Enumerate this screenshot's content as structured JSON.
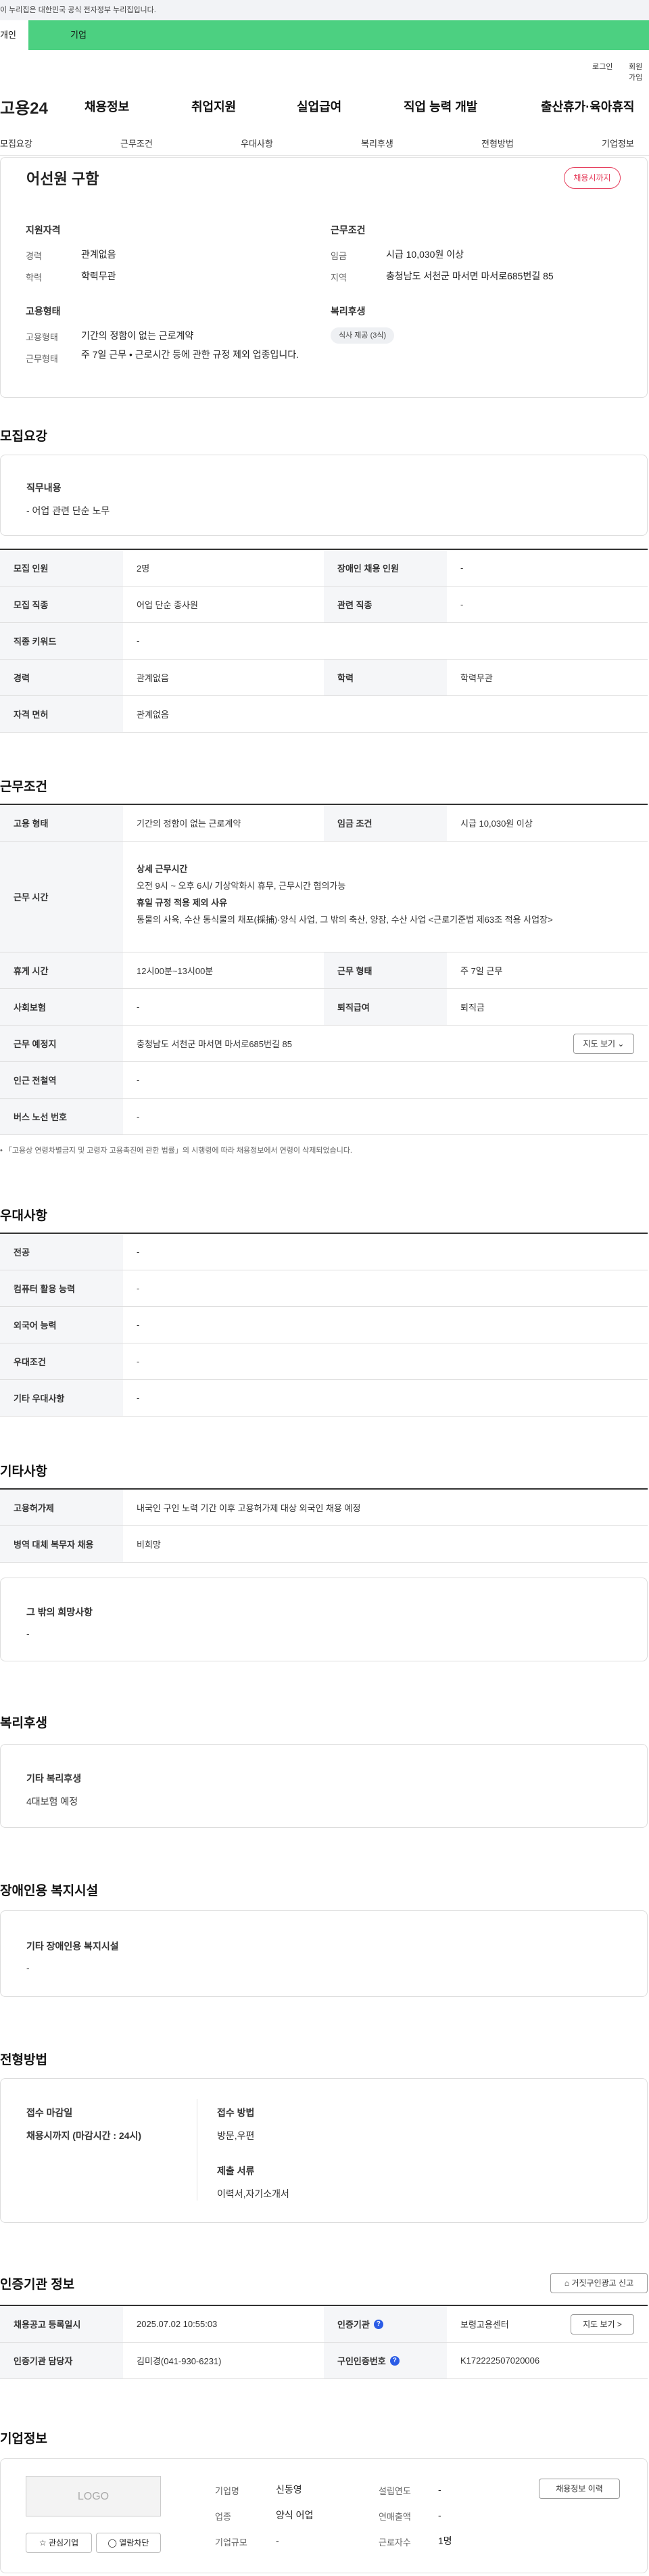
{
  "gov_banner": "이 누리집은 대한민국 공식 전자정부 누리집입니다.",
  "user_tabs": [
    "개인",
    "기업"
  ],
  "util": {
    "login": "로그인",
    "signup": "회원가입"
  },
  "gnb": {
    "logo": "고용24",
    "menus": [
      "채용정보",
      "취업지원",
      "실업급여",
      "직업 능력 개발",
      "출산휴가·육아휴직"
    ]
  },
  "subnav": [
    "모집요강",
    "근무조건",
    "우대사항",
    "복리후생",
    "전형방법",
    "기업정보"
  ],
  "summary": {
    "title": "어선원 구함",
    "badge": "채용시까지",
    "qual_h": "지원자격",
    "cond_h": "근무조건",
    "exp_k": "경력",
    "exp_v": "관계없음",
    "edu_k": "학력",
    "edu_v": "학력무관",
    "wage_k": "임금",
    "wage_v": "시급 10,030원 이상",
    "area_k": "지역",
    "area_v": "충청남도 서천군 마서면 마서로685번길 85",
    "emp_h": "고용형태",
    "welfare_h": "복리후생",
    "type_k": "고용형태",
    "type_v": "기간의 정함이 없는 근로계약",
    "form_k": "근무형태",
    "form_v": "주 7일 근무 • 근로시간 등에 관한 규정 제외 업종입니다.",
    "chip": "식사 제공 (3식)"
  },
  "recruit": {
    "h": "모집요강",
    "duty_h": "직무내용",
    "duty_v": "- 어업 관련 단순 노무",
    "rows": [
      [
        "모집 인원",
        "2명",
        "장애인 채용 인원",
        "-"
      ],
      [
        "모집 직종",
        "어업 단순 종사원",
        "관련 직종",
        "-"
      ],
      [
        "직종 키워드",
        "-"
      ],
      [
        "경력",
        "관계없음",
        "학력",
        "학력무관"
      ],
      [
        "자격 면허",
        "관계없음"
      ]
    ]
  },
  "conditions": {
    "h": "근무조건",
    "type_k": "고용 형태",
    "type_v": "기간의 정함이 없는 근로계약",
    "wage_k": "임금 조건",
    "wage_v": "시급 10,030원 이상",
    "time_k": "근무 시간",
    "time_l1": "상세 근무시간",
    "time_l2": "오전 9시 ~ 오후 6시/ 기상악화시 휴무, 근무시간 협의가능",
    "time_l3": "휴일 규정 적용 제외 사유",
    "time_l4": "동물의 사육, 수산 동식물의 채포(採捕)·양식 사업, 그 밖의 축산, 양잠, 수산 사업 <근로기준법 제63조 적용 사업장>",
    "rest_k": "휴게 시간",
    "rest_v": "12시00분~13시00분",
    "form_k": "근무 형태",
    "form_v": "주 7일 근무",
    "ins_k": "사회보험",
    "ins_v": "-",
    "ret_k": "퇴직급여",
    "ret_v": "퇴직금",
    "place_k": "근무 예정지",
    "place_v": "충청남도 서천군 마서면 마서로685번길 85",
    "map_btn": "지도 보기 ⌄",
    "subway_k": "인근 전철역",
    "subway_v": "-",
    "bus_k": "버스 노선 번호",
    "bus_v": "-",
    "note": "「고용상 연령차별금지 및 고령자 고용촉진에 관한 법률」의 시행령에 따라 채용정보에서 연령이 삭제되었습니다."
  },
  "prefer": {
    "h": "우대사항",
    "rows": [
      [
        "전공",
        "-"
      ],
      [
        "컴퓨터 활용 능력",
        "-"
      ],
      [
        "외국어 능력",
        "-"
      ],
      [
        "우대조건",
        "-"
      ],
      [
        "기타 우대사항",
        "-"
      ]
    ]
  },
  "etc": {
    "h": "기타사항",
    "rows": [
      [
        "고용허가제",
        "내국인 구인 노력 기간 이후 고용허가제 대상 외국인 채용 예정"
      ],
      [
        "병역 대체 복무자 채용",
        "비희망"
      ]
    ],
    "other_h": "그 밖의 희망사항",
    "other_v": "-"
  },
  "welfare": {
    "h": "복리후생",
    "sub_h": "기타 복리후생",
    "sub_v": "4대보험 예정"
  },
  "disabled": {
    "h": "장애인용 복지시설",
    "sub_h": "기타 장애인용 복지시설",
    "sub_v": "-"
  },
  "process": {
    "h": "전형방법",
    "deadline_h": "접수 마감일",
    "deadline_v": "채용시까지 (마감시간 : 24시)",
    "method_h": "접수 방법",
    "method_v": "방문,우편",
    "docs_h": "제출 서류",
    "docs_v": "이력서,자기소개서"
  },
  "cert": {
    "h": "인증기관 정보",
    "report_btn": "거짓구인광고 신고",
    "reg_k": "채용공고 등록일시",
    "reg_v": "2025.07.02 10:55:03",
    "org_k": "인증기관",
    "org_v": "보령고용센터",
    "map_btn": "지도 보기 >",
    "mgr_k": "인증기관 담당자",
    "mgr_v": "김미경(041-930-6231)",
    "num_k": "구인인증번호",
    "num_v": "K172222507020006"
  },
  "company": {
    "h": "기업정보",
    "logo": "LOGO",
    "fav_btn": "☆ 관심기업",
    "view_btn": "◯ 열람차단",
    "name_k": "기업명",
    "name_v": "신동영",
    "found_k": "설립연도",
    "found_v": "-",
    "list_btn": "채용정보 이력",
    "ind_k": "업종",
    "ind_v": "양식 어업",
    "sales_k": "연매출액",
    "sales_v": "-",
    "size_k": "기업규모",
    "size_v": "-",
    "emp_k": "근로자수",
    "emp_v": "1명"
  }
}
